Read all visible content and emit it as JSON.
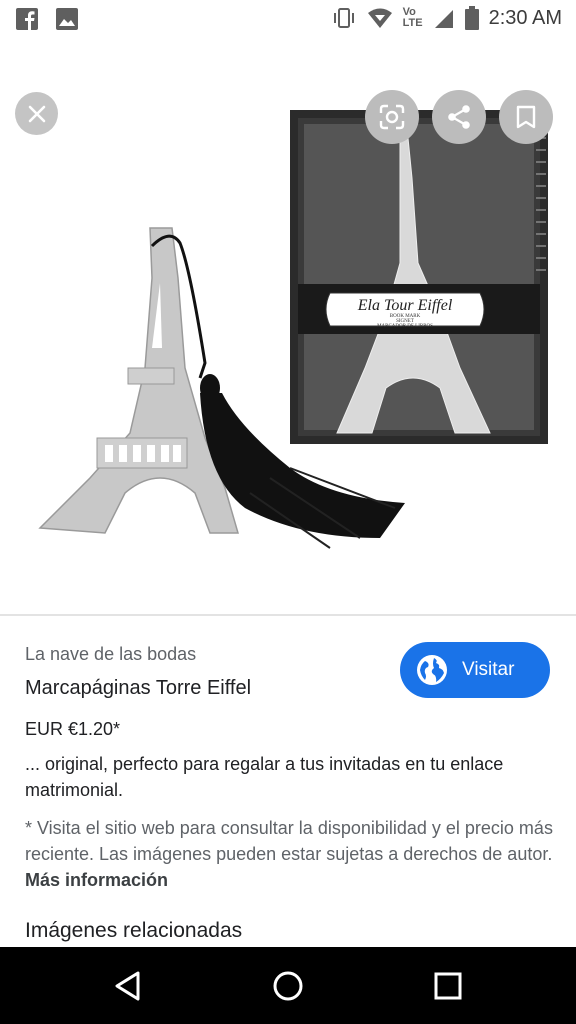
{
  "status_bar": {
    "time": "2:30 AM",
    "icons": [
      "facebook-icon",
      "gallery-icon",
      "vibrate-icon",
      "wifi-icon",
      "volte-icon",
      "signal-icon",
      "battery-icon"
    ],
    "volte_label_top": "Vo",
    "volte_label_bottom": "LTE"
  },
  "toolbar": {
    "close": "close-icon",
    "lens": "lens-icon",
    "share": "share-icon",
    "save": "bookmark-icon"
  },
  "image": {
    "description_icon": "product-photo",
    "box_label_line1": "Ela Tour Eiffel",
    "box_label_line2": "BOOK MARK",
    "box_label_line3": "SIGNET",
    "box_label_line4": "MARCADOR DE LIBROS"
  },
  "result": {
    "source": "La nave de las bodas",
    "title": "Marcapáginas Torre Eiffel",
    "price": "EUR €1.20*",
    "description": "... original, perfecto para regalar a tus invitadas en tu enlace matrimonial.",
    "disclaimer": "* Visita el sitio web para consultar la disponibilidad y el precio más reciente. Las imágenes pueden estar sujetas a derechos de autor.",
    "more_info": "Más información",
    "visit_label": "Visitar",
    "related_heading": "Imágenes relacionadas"
  },
  "colors": {
    "accent": "#1a73e8",
    "fab_bg": "#bcbcbc",
    "navbar": "#000000"
  }
}
